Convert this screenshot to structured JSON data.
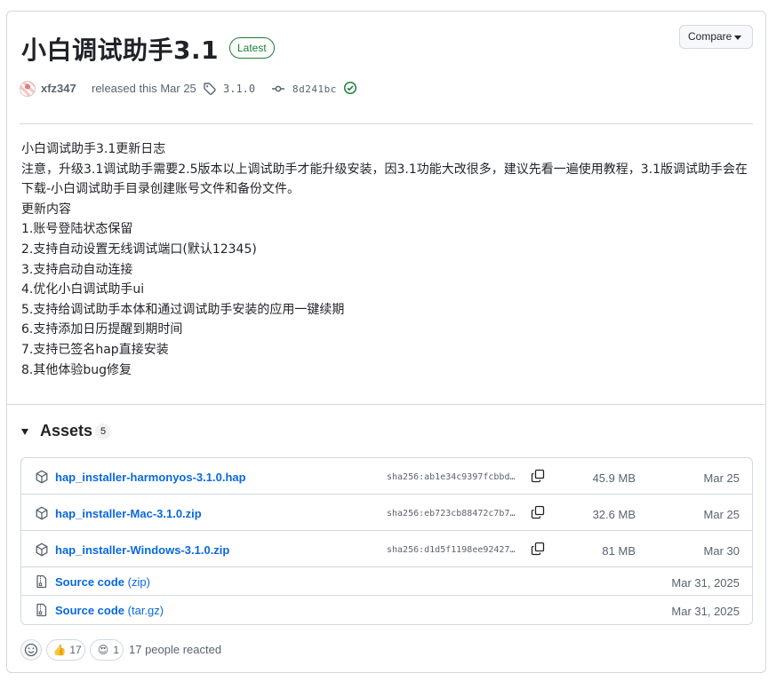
{
  "release": {
    "title": "小白调试助手3.1",
    "badge": "Latest",
    "compare_label": "Compare",
    "author": "xfz347",
    "released_text": "released this Mar 25",
    "tag": "3.1.0",
    "commit": "8d241bc"
  },
  "notes": [
    "小白调试助手3.1更新日志",
    "注意，升级3.1调试助手需要2.5版本以上调试助手才能升级安装，因3.1功能大改很多，建议先看一遍使用教程，3.1版调试助手会在下载-小白调试助手目录创建账号文件和备份文件。",
    "更新内容",
    "1.账号登陆状态保留",
    "2.支持自动设置无线调试端口(默认12345)",
    "3.支持启动自动连接",
    "4.优化小白调试助手ui",
    "5.支持给调试助手本体和通过调试助手安装的应用一键续期",
    "6.支持添加日历提醒到期时间",
    "7.支持已签名hap直接安装",
    "8.其他体验bug修复"
  ],
  "assets": {
    "label": "Assets",
    "count": "5",
    "files": [
      {
        "name": "hap_installer-harmonyos-3.1.0.hap",
        "sha": "sha256:ab1e34c9397fcbbd…",
        "size": "45.9 MB",
        "date": "Mar 25"
      },
      {
        "name": "hap_installer-Mac-3.1.0.zip",
        "sha": "sha256:eb723cb88472c7b7…",
        "size": "32.6 MB",
        "date": "Mar 25"
      },
      {
        "name": "hap_installer-Windows-3.1.0.zip",
        "sha": "sha256:d1d5f1198ee92427…",
        "size": "81 MB",
        "date": "Mar 30"
      }
    ],
    "sources": [
      {
        "name": "Source code",
        "ext": "(zip)",
        "date": "Mar 31, 2025"
      },
      {
        "name": "Source code",
        "ext": "(tar.gz)",
        "date": "Mar 31, 2025"
      }
    ]
  },
  "reactions": {
    "items": [
      {
        "emoji": "👍",
        "count": "17"
      },
      {
        "emoji": "😍",
        "count": "1"
      }
    ],
    "summary": "17 people reacted"
  },
  "icons": {
    "package": "package-icon",
    "copy": "copy-icon",
    "zip": "file-zip-icon",
    "tag": "tag-icon",
    "commit": "git-commit-icon",
    "check": "check-circle-icon",
    "smiley": "smiley-icon"
  },
  "colors": {
    "link": "#0969da",
    "latest_green": "#1a7f37",
    "border": "#d1d9e0",
    "muted": "#59636e"
  }
}
